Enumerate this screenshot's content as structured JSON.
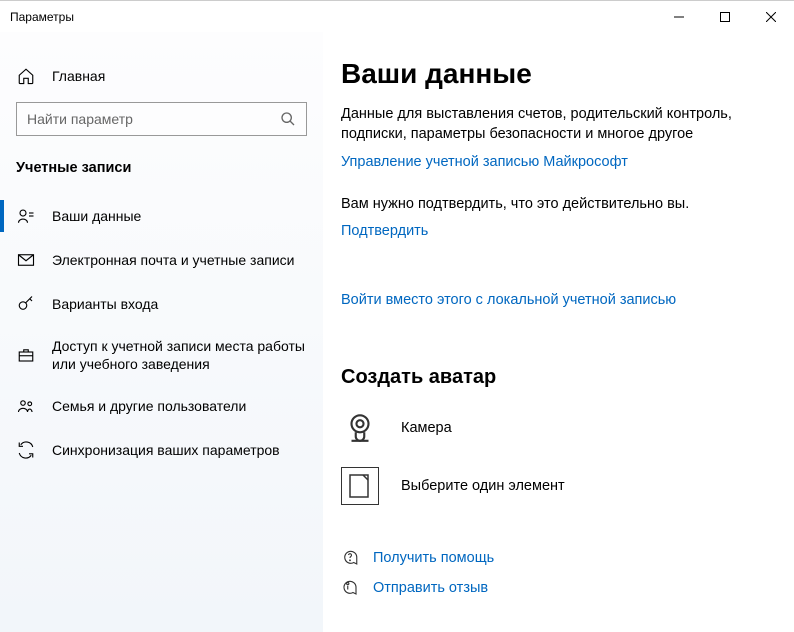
{
  "window": {
    "title": "Параметры"
  },
  "sidebar": {
    "home": "Главная",
    "search_placeholder": "Найти параметр",
    "section": "Учетные записи",
    "items": [
      {
        "label": "Ваши данные"
      },
      {
        "label": "Электронная почта и учетные записи"
      },
      {
        "label": "Варианты входа"
      },
      {
        "label": "Доступ к учетной записи места работы или учебного заведения"
      },
      {
        "label": "Семья и другие пользователи"
      },
      {
        "label": "Синхронизация ваших параметров"
      }
    ]
  },
  "main": {
    "heading": "Ваши данные",
    "desc": "Данные для выставления счетов, родительский контроль, подписки, параметры безопасности и многое другое",
    "manage_link": "Управление учетной записью Майкрософт",
    "verify_text": "Вам нужно подтвердить, что это действительно вы.",
    "verify_link": "Подтвердить",
    "local_link": "Войти вместо этого с локальной учетной записью",
    "avatar_heading": "Создать аватар",
    "camera": "Камера",
    "browse": "Выберите один элемент",
    "help": "Получить помощь",
    "feedback": "Отправить отзыв"
  }
}
